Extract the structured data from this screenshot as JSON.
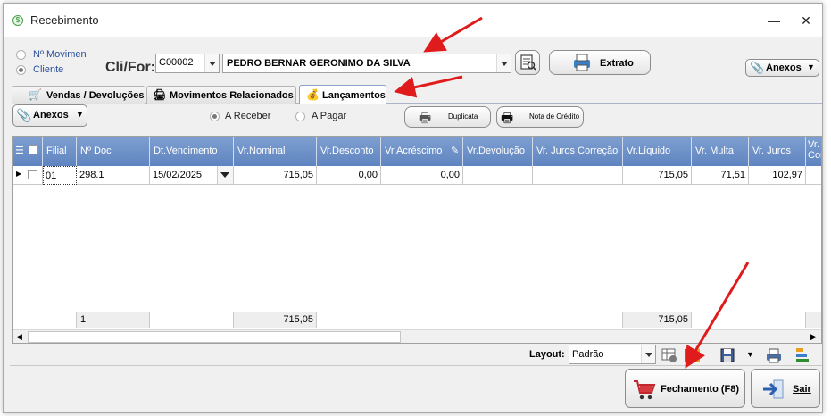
{
  "window": {
    "title": "Recebimento",
    "min_label": "—",
    "close_label": "✕"
  },
  "filter": {
    "radio_nmov": "Nº Movimen",
    "radio_cliente": "Cliente",
    "clifor_label": "Cli/For:",
    "code": "C00002",
    "name": "PEDRO BERNAR GERONIMO DA SILVA",
    "extrato_label": "Extrato",
    "anexos_label": "Anexos"
  },
  "tabs": [
    {
      "label": "Vendas / Devoluções",
      "icon": "cart-icon"
    },
    {
      "label": "Movimentos Relacionados",
      "icon": "printer-icon"
    },
    {
      "label": "Lançamentos",
      "icon": "money-bag-icon"
    }
  ],
  "toolbar": {
    "anexos_label": "Anexos",
    "receber_label": "A Receber",
    "pagar_label": "A Pagar",
    "duplicata_label": "Duplicata",
    "nota_credito_label": "Nota de Crédito"
  },
  "grid": {
    "columns": [
      "Filial",
      "Nº Doc",
      "Dt.Vencimento",
      "Vr.Nominal",
      "Vr.Desconto",
      "Vr.Acréscimo",
      "Vr.Devolução",
      "Vr. Juros Correção",
      "Vr.Líquido",
      "Vr. Multa",
      "Vr. Juros",
      "Vr. Cor"
    ],
    "rows": [
      {
        "filial": "01",
        "doc": "298.1",
        "vencimento": "15/02/2025",
        "nominal": "715,05",
        "desconto": "0,00",
        "acrescimo": "0,00",
        "devolucao": "",
        "juros_correcao": "",
        "liquido": "715,05",
        "multa": "71,51",
        "juros": "102,97"
      }
    ],
    "footer": {
      "count": "1",
      "nominal_total": "715,05",
      "liquido_total": "715,05"
    }
  },
  "layout": {
    "label": "Layout:",
    "value": "Padrão"
  },
  "bottom": {
    "fechamento_label": "Fechamento (F8)",
    "sair_label": "Sair"
  },
  "colors": {
    "header_blue": "#6a8fc8",
    "arrow_red": "#e01b1b"
  }
}
